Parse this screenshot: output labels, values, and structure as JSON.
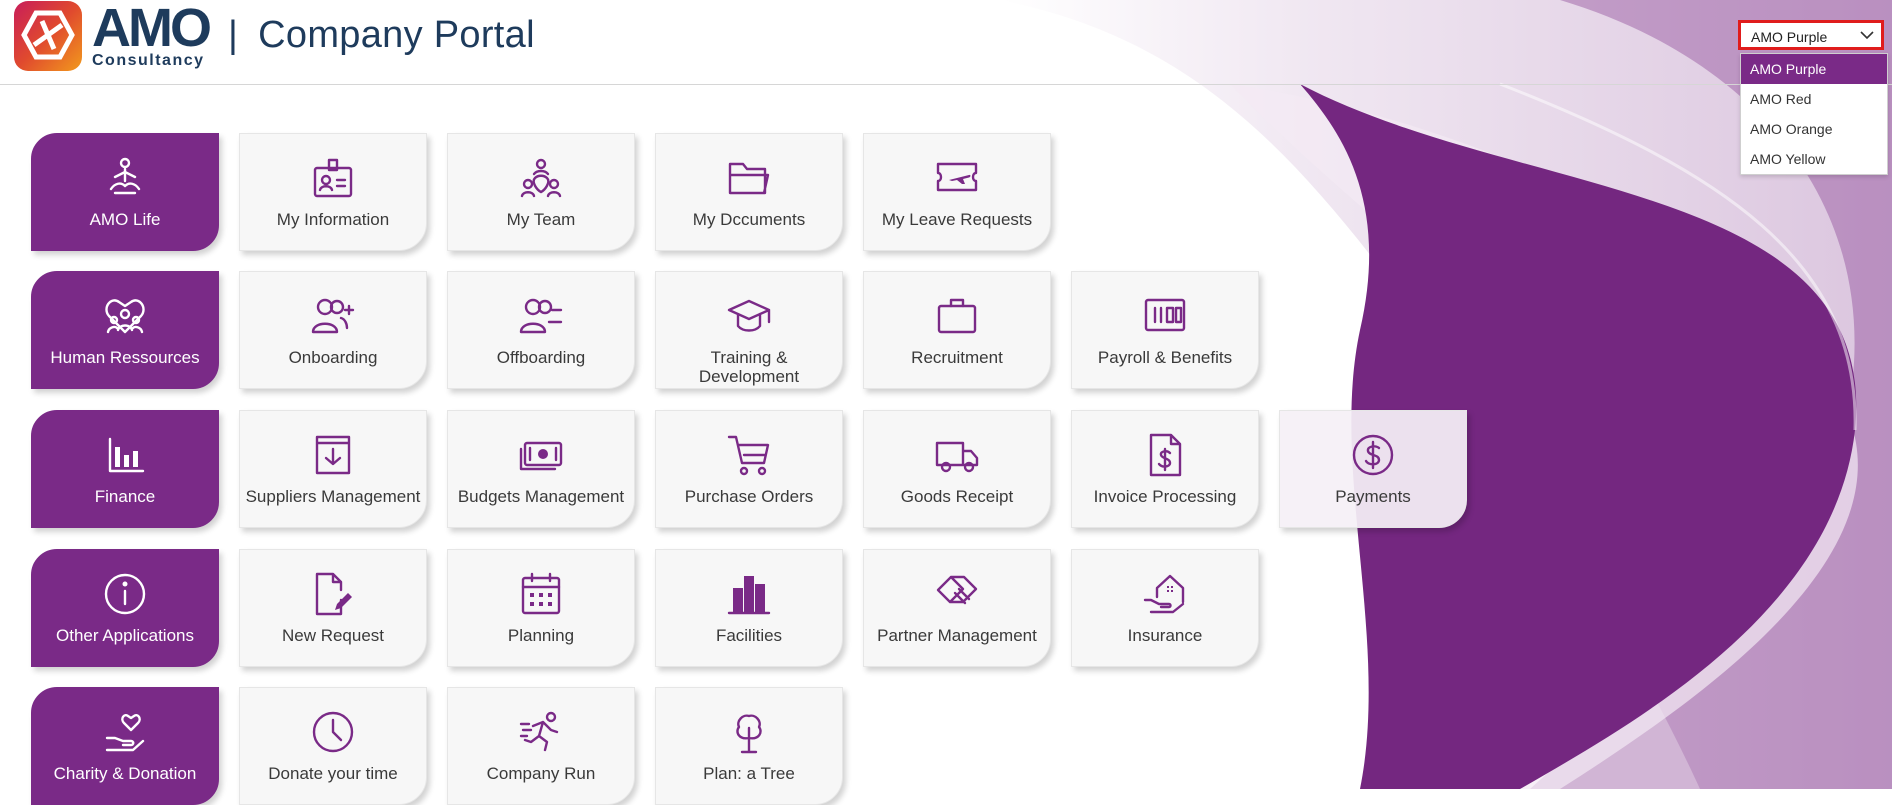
{
  "header": {
    "logo_text": "AMO",
    "logo_subtext": "Consultancy",
    "separator": "|",
    "title": "Company Portal"
  },
  "theme_selector": {
    "selected": "AMO Purple",
    "options": [
      "AMO Purple",
      "AMO Red",
      "AMO Orange",
      "AMO Yellow"
    ]
  },
  "colors": {
    "accent": "#7a2a87",
    "header_text": "#1e3b5c",
    "highlight_border": "#e01c1c"
  },
  "rows": [
    {
      "category": {
        "label": "AMO Life",
        "icon": "meditation-icon"
      },
      "tiles": [
        {
          "label": "My Information",
          "icon": "id-badge-icon"
        },
        {
          "label": "My Team",
          "icon": "team-icon"
        },
        {
          "label": "My Dccuments",
          "icon": "folder-icon"
        },
        {
          "label": "My Leave Requests",
          "icon": "plane-ticket-icon"
        }
      ]
    },
    {
      "category": {
        "label": "Human Ressources",
        "icon": "people-heart-icon"
      },
      "tiles": [
        {
          "label": "Onboarding",
          "icon": "user-add-icon"
        },
        {
          "label": "Offboarding",
          "icon": "user-remove-icon"
        },
        {
          "label": "Training & Development",
          "icon": "graduation-cap-icon"
        },
        {
          "label": "Recruitment",
          "icon": "briefcase-icon"
        },
        {
          "label": "Payroll & Benefits",
          "icon": "cash-register-icon"
        }
      ]
    },
    {
      "category": {
        "label": "Finance",
        "icon": "bar-chart-icon"
      },
      "tiles": [
        {
          "label": "Suppliers Management",
          "icon": "inbox-download-icon"
        },
        {
          "label": "Budgets Management",
          "icon": "money-icon"
        },
        {
          "label": "Purchase Orders",
          "icon": "shopping-cart-icon"
        },
        {
          "label": "Goods Receipt",
          "icon": "truck-icon"
        },
        {
          "label": "Invoice Processing",
          "icon": "invoice-dollar-icon"
        },
        {
          "label": "Payments",
          "icon": "dollar-circle-icon"
        }
      ]
    },
    {
      "category": {
        "label": "Other Applications",
        "icon": "info-circle-icon"
      },
      "tiles": [
        {
          "label": "New Request",
          "icon": "document-edit-icon"
        },
        {
          "label": "Planning",
          "icon": "calendar-icon"
        },
        {
          "label": "Facilities",
          "icon": "buildings-icon"
        },
        {
          "label": "Partner Management",
          "icon": "handshake-icon"
        },
        {
          "label": "Insurance",
          "icon": "house-hand-icon"
        }
      ]
    },
    {
      "category": {
        "label": "Charity & Donation",
        "icon": "heart-hand-icon"
      },
      "tiles": [
        {
          "label": "Donate your time",
          "icon": "clock-icon"
        },
        {
          "label": "Company Run",
          "icon": "runner-icon"
        },
        {
          "label": "Plan: a Tree",
          "icon": "tree-icon"
        }
      ]
    }
  ]
}
